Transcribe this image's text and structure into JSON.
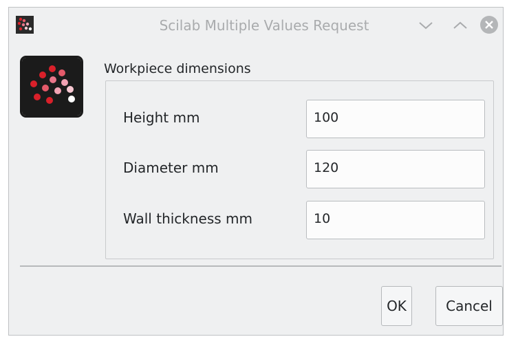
{
  "window": {
    "title": "Scilab Multiple Values Request",
    "icons": {
      "app": "scilab-logo-icon",
      "minimize": "chevron-down-icon",
      "maximize": "chevron-up-icon",
      "close": "close-icon"
    }
  },
  "form": {
    "group_label": "Workpiece dimensions",
    "fields": [
      {
        "label": "Height mm",
        "value": "100"
      },
      {
        "label": "Diameter mm",
        "value": "120"
      },
      {
        "label": "Wall thickness mm",
        "value": "10"
      }
    ]
  },
  "buttons": {
    "ok_label": "OK",
    "cancel_label": "Cancel"
  },
  "colors": {
    "background": "#eff0f1",
    "logo_red": "#d9202a",
    "logo_pink": "#f2a3b4",
    "logo_dark": "#1b1b1b"
  }
}
